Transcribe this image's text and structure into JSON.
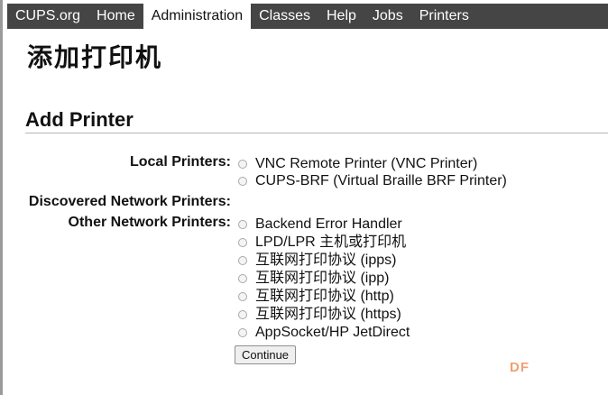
{
  "nav": {
    "items": [
      {
        "label": "CUPS.org"
      },
      {
        "label": "Home"
      },
      {
        "label": "Administration"
      },
      {
        "label": "Classes"
      },
      {
        "label": "Help"
      },
      {
        "label": "Jobs"
      },
      {
        "label": "Printers"
      }
    ],
    "active_item": "Administration"
  },
  "page_title": "添加打印机",
  "section_heading": "Add Printer",
  "groups": {
    "local": {
      "label": "Local Printers:",
      "options": [
        "VNC Remote Printer (VNC Printer)",
        "CUPS-BRF (Virtual Braille BRF Printer)"
      ]
    },
    "discovered": {
      "label": "Discovered Network Printers:"
    },
    "other": {
      "label": "Other Network Printers:",
      "options": [
        "Backend Error Handler",
        "LPD/LPR 主机或打印机",
        "互联网打印协议 (ipps)",
        "互联网打印协议 (ipp)",
        "互联网打印协议 (http)",
        "互联网打印协议 (https)",
        "AppSocket/HP JetDirect"
      ]
    }
  },
  "continue_label": "Continue",
  "watermark": "DF",
  "colors": {
    "navbar_bg": "#454545",
    "navbar_text": "#ffffff",
    "active_tab_bg": "#ffffff",
    "watermark": "#f0a070"
  }
}
